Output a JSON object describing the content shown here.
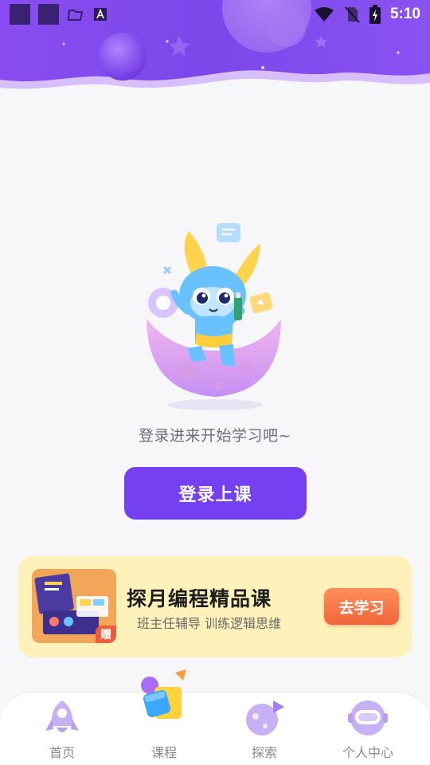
{
  "status_bar": {
    "time": "5:10"
  },
  "main": {
    "empty_message": "登录进来开始学习吧~",
    "login_button": "登录上课"
  },
  "promo": {
    "title": "探月编程精品课",
    "subtitle": "班主任辅导 训练逻辑思维",
    "button": "去学习",
    "badge": "赠"
  },
  "nav": {
    "items": [
      {
        "label": "首页",
        "icon": "rocket-icon"
      },
      {
        "label": "课程",
        "icon": "course-blocks-icon"
      },
      {
        "label": "探索",
        "icon": "planet-icon"
      },
      {
        "label": "个人中心",
        "icon": "astronaut-helmet-icon"
      }
    ],
    "active_index": 1
  },
  "colors": {
    "primary": "#7440f2",
    "promo_bg": "#fef1ba",
    "promo_button": "#f0653a",
    "nav_inactive": "#8a8796"
  }
}
